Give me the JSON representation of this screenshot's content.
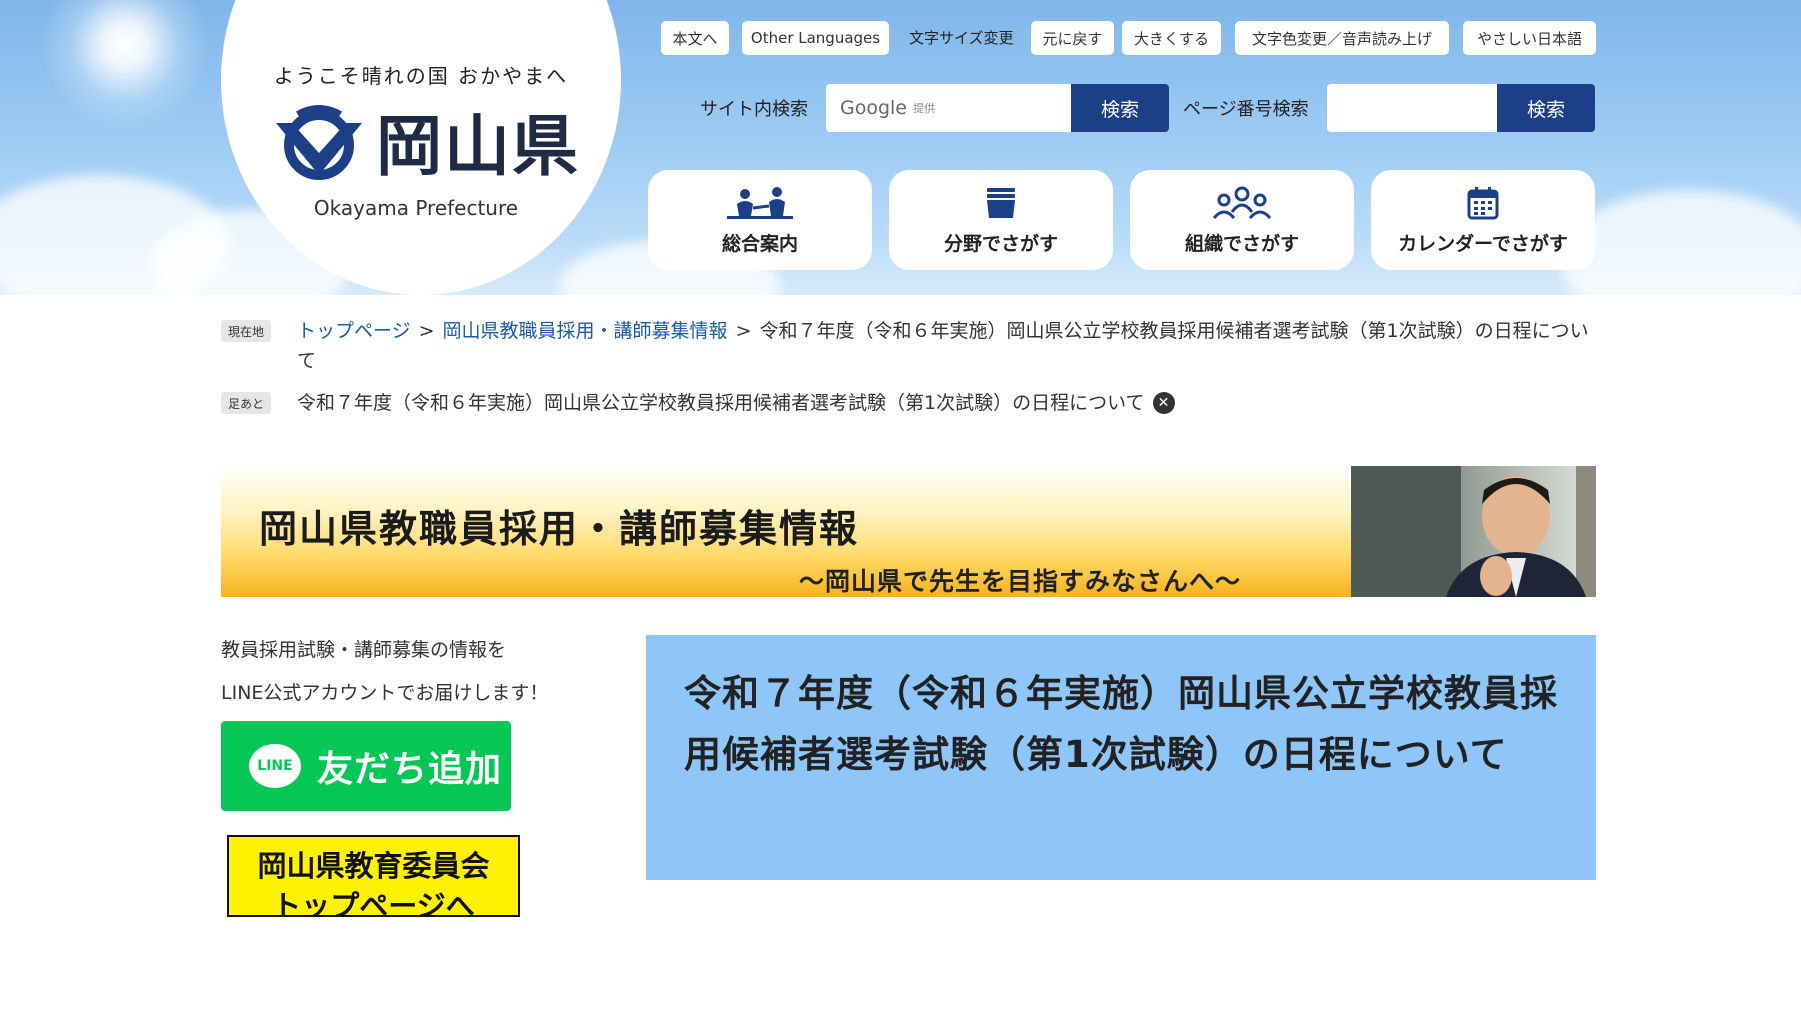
{
  "header": {
    "logo_tagline": "ようこそ晴れの国 おかやまへ",
    "logo_name": "岡山県",
    "logo_english": "Okayama Prefecture",
    "util_links": {
      "honbun": "本文へ",
      "other_languages": "Other Languages",
      "font_size_label": "文字サイズ変更",
      "reset": "元に戻す",
      "enlarge": "大きくする",
      "color_voice": "文字色変更／音声読み上げ",
      "easy_japanese": "やさしい日本語"
    },
    "site_search": {
      "label": "サイト内検索",
      "placeholder_brand": "Google",
      "placeholder_suffix": "提供",
      "button": "検索"
    },
    "page_number_search": {
      "label": "ページ番号検索",
      "value": "",
      "button": "検索"
    },
    "nav": [
      {
        "label": "総合案内",
        "icon": "people-icon"
      },
      {
        "label": "分野でさがす",
        "icon": "box-icon"
      },
      {
        "label": "組織でさがす",
        "icon": "org-icon"
      },
      {
        "label": "カレンダーでさがす",
        "icon": "calendar-icon"
      }
    ]
  },
  "breadcrumb": {
    "current_badge": "現在地",
    "items": [
      "トップページ",
      "岡山県教職員採用・講師募集情報"
    ],
    "separator": ">",
    "current_page": "令和７年度（令和６年実施）岡山県公立学校教員採用候補者選考試験（第1次試験）の日程について",
    "history_badge": "足あと",
    "history_item": "令和７年度（令和６年実施）岡山県公立学校教員採用候補者選考試験（第1次試験）の日程について"
  },
  "banner": {
    "title": "岡山県教職員採用・講師募集情報",
    "subtitle": "～岡山県で先生を目指すみなさんへ～"
  },
  "sidebar": {
    "intro_line1": "教員採用試験・講師募集の情報を",
    "intro_line2": "LINE公式アカウントでお届けします！",
    "line_badge": "LINE",
    "line_button": "友だち追加",
    "board_line1": "岡山県教育委員会",
    "board_line2": "トップページへ"
  },
  "main": {
    "page_title": "令和７年度（令和６年実施）岡山県公立学校教員採用候補者選考試験（第1次試験）の日程について"
  },
  "colors": {
    "nav_blue": "#1c3f87",
    "link_blue": "#1a5aa8",
    "title_bg": "#8ec6fa",
    "line_green": "#06c755",
    "board_yellow": "#fff200"
  }
}
